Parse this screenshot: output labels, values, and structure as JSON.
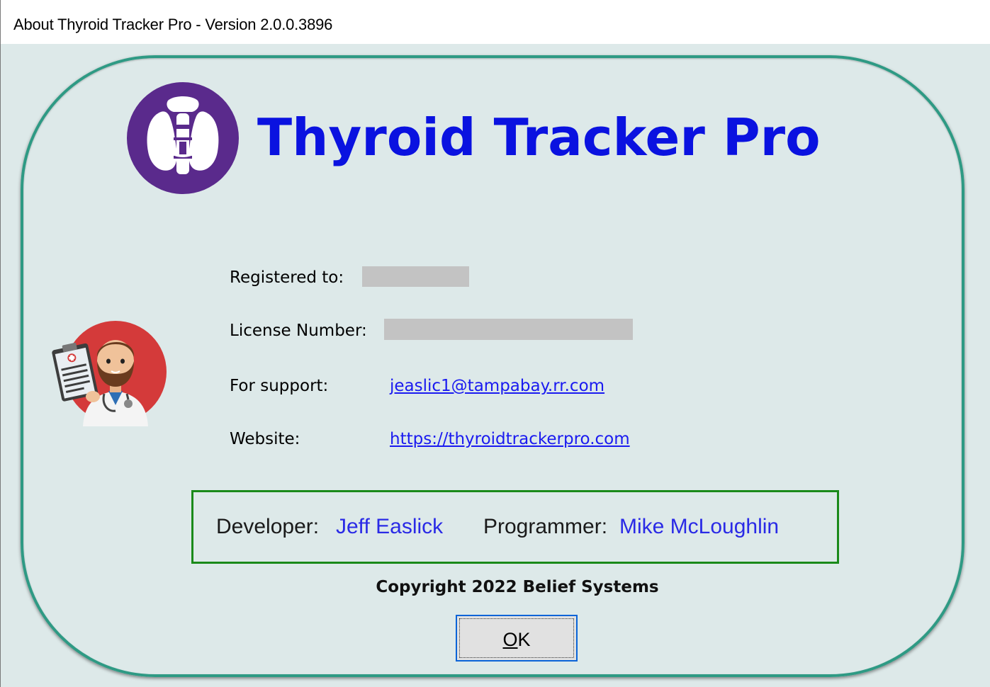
{
  "window": {
    "title": "About Thyroid Tracker Pro - Version 2.0.0.3896"
  },
  "header": {
    "app_name": "Thyroid Tracker Pro",
    "brand_color": "#0a12e0",
    "logo_icon": "thyroid-gland-icon"
  },
  "info": {
    "registered_label": "Registered to:",
    "license_label": "License Number:",
    "support_label": "For support:",
    "support_email": "jeaslic1@tampabay.rr.com",
    "website_label": "Website:",
    "website_url": "https://thyroidtrackerpro.com"
  },
  "credits": {
    "developer_label": "Developer:",
    "developer_name": "Jeff Easlick",
    "programmer_label": "Programmer:",
    "programmer_name": "Mike McLoughlin"
  },
  "footer": {
    "copyright": "Copyright 2022 Belief Systems",
    "ok_accel": "O",
    "ok_rest": "K"
  },
  "colors": {
    "frame": "#2e9a84",
    "background": "#dde9e9",
    "link": "#1a1af0",
    "credits_border": "#1a8a1a"
  }
}
